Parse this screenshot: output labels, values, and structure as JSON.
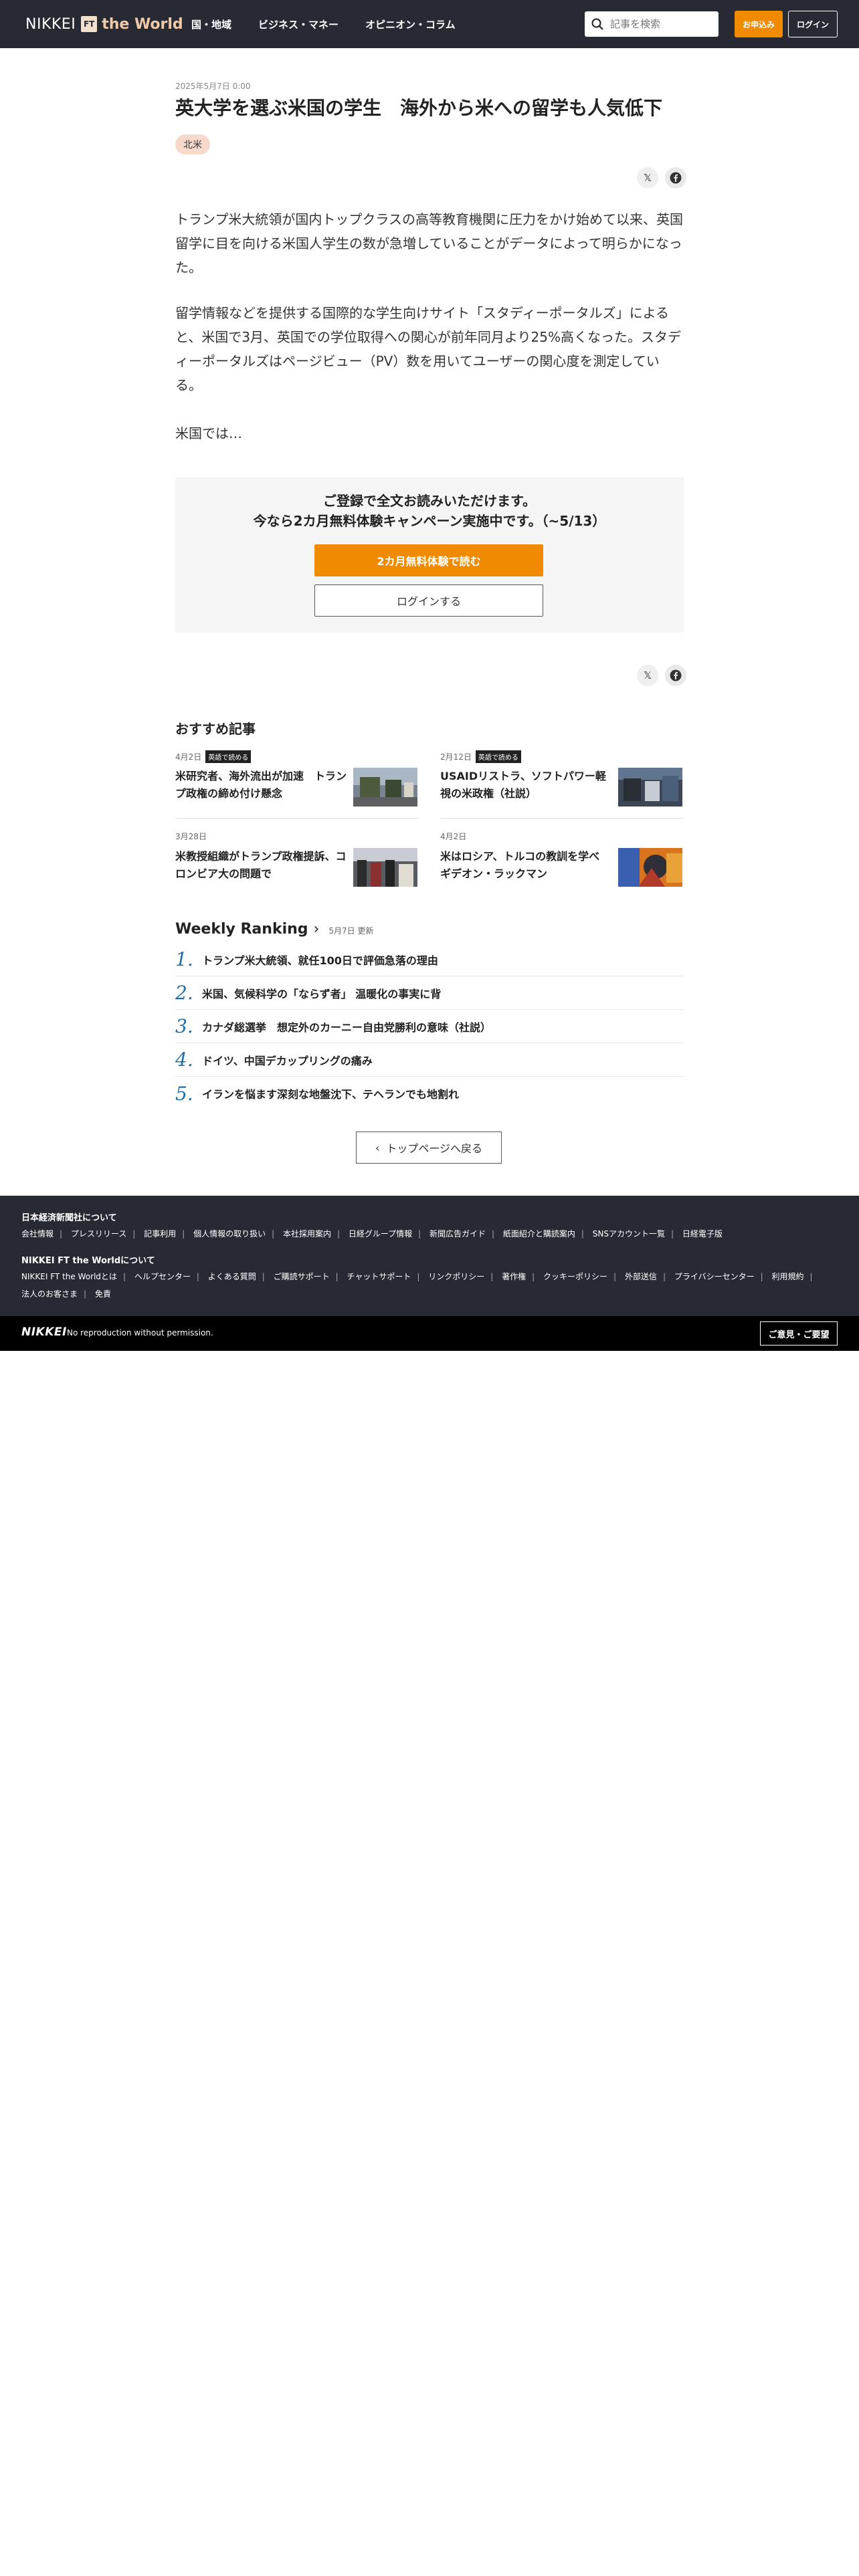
{
  "header": {
    "logo_nikkei": "NIKKEI",
    "logo_ft": "FT",
    "logo_world": "the World",
    "nav": [
      "国・地域",
      "ビジネス・マネー",
      "オピニオン・コラム"
    ],
    "search_placeholder": "記事を検索",
    "subscribe_label": "お申込み",
    "login_label": "ログイン",
    "accent_color": "#f08a00"
  },
  "article": {
    "date": "2025年5月7日 0:00",
    "title": "英大学を選ぶ米国の学生　海外から米への留学も人気低下",
    "tag": "北米",
    "share_icons": [
      "x-icon",
      "facebook-icon"
    ],
    "paragraphs": [
      "トランプ米大統領が国内トップクラスの高等教育機関に圧力をかけ始めて以来、英国留学に目を向ける米国人学生の数が急増していることがデータによって明らかになった。",
      "留学情報などを提供する国際的な学生向けサイト「スタディーポータルズ」によると、米国で3月、英国での学位取得への関心が前年同月より25%高くなった。スタディーポータルズはページビュー（PV）数を用いてユーザーの関心度を測定している。",
      "米国では…"
    ]
  },
  "paywall": {
    "line1": "ご登録で全文お読みいただけます。",
    "line2": "今なら2カ月無料体験キャンペーン実施中です。（~5/13）",
    "trial_label": "2カ月無料体験で読む",
    "login_label": "ログインする"
  },
  "recommended": {
    "heading": "おすすめ記事",
    "items": [
      {
        "date": "4月2日",
        "badge": "英語で読める",
        "title": "米研究者、海外流出が加速　トランプ政権の締め付け懸念"
      },
      {
        "date": "2月12日",
        "badge": "英語で読める",
        "title": "USAIDリストラ、ソフトパワー軽視の米政権（社説）"
      },
      {
        "date": "3月28日",
        "badge": "",
        "title": "米教授組織がトランプ政権提訴、コロンビア大の問題で"
      },
      {
        "date": "4月2日",
        "badge": "",
        "title": "米はロシア、トルコの教訓を学べ　ギデオン・ラックマン"
      }
    ]
  },
  "ranking": {
    "title": "Weekly Ranking",
    "updated": "5月7日 更新",
    "items": [
      {
        "num": "1.",
        "title": "トランプ米大統領、就任100日で評価急落の理由"
      },
      {
        "num": "2.",
        "title": "米国、気候科学の「ならず者」 温暖化の事実に背"
      },
      {
        "num": "3.",
        "title": "カナダ総選挙　想定外のカーニー自由党勝利の意味（社説）"
      },
      {
        "num": "4.",
        "title": "ドイツ、中国デカップリングの痛み"
      },
      {
        "num": "5.",
        "title": "イランを悩ます深刻な地盤沈下、テヘランでも地割れ"
      }
    ]
  },
  "back_label": "トップページへ戻る",
  "footer": {
    "section1_title": "日本経済新聞社について",
    "section1_links": [
      "会社情報",
      "プレスリリース",
      "記事利用",
      "個人情報の取り扱い",
      "本社採用案内",
      "日経グループ情報",
      "新聞広告ガイド",
      "紙面紹介と購読案内",
      "SNSアカウント一覧",
      "日経電子版"
    ],
    "section2_title": "NIKKEI FT the Worldについて",
    "section2_links": [
      "NIKKEI FT the Worldとは",
      "ヘルプセンター",
      "よくある質問",
      "ご購読サポート",
      "チャットサポート",
      "リンクポリシー",
      "著作権",
      "クッキーポリシー",
      "外部送信",
      "プライバシーセンター",
      "利用規約",
      "法人のお客さま",
      "免責"
    ],
    "brand": "NIKKEI",
    "copyright": "No reproduction without permission.",
    "feedback_label": "ご意見・ご要望"
  }
}
